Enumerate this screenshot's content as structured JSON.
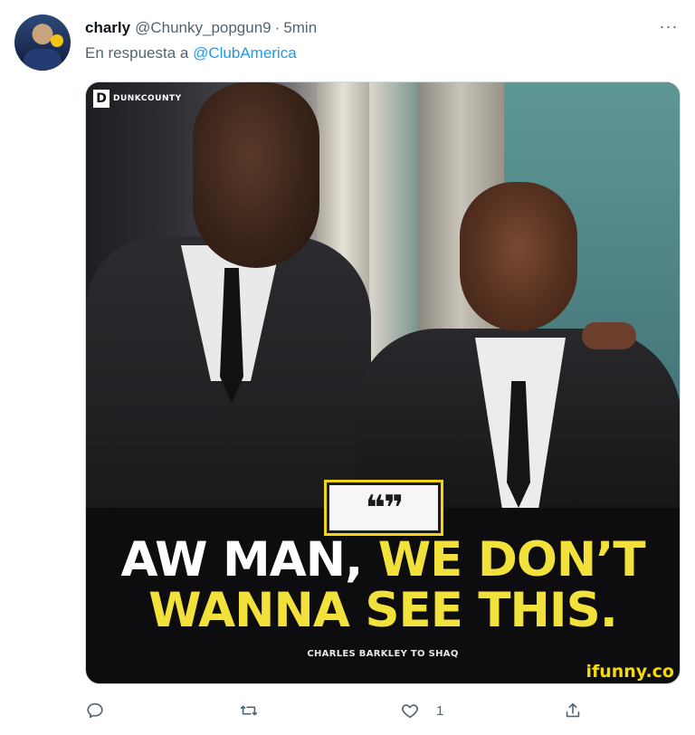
{
  "tweet": {
    "author_name": "charly",
    "author_handle": "@Chunky_popgun9",
    "separator": "·",
    "time": "5min",
    "reply_prefix": "En respuesta a",
    "reply_mention": "@ClubAmerica",
    "more_label": "···"
  },
  "media": {
    "source_logo_letter": "D",
    "source_logo_text": "DUNKCOUNTY",
    "quote_symbol": "❝❞",
    "caption_white": "AW MAN,",
    "caption_yellow_line1": "WE DON’T",
    "caption_yellow_line2": "WANNA SEE THIS.",
    "attribution": "CHARLES BARKLEY TO SHAQ",
    "watermark": "ifunny.co"
  },
  "actions": {
    "reply_icon": "reply-icon",
    "retweet_icon": "retweet-icon",
    "like_icon": "heart-icon",
    "like_count": "1",
    "share_icon": "share-icon"
  },
  "colors": {
    "link": "#1d9bf0",
    "muted": "#536471",
    "caption_yellow": "#f1e13a",
    "watermark": "#f5d90a"
  }
}
